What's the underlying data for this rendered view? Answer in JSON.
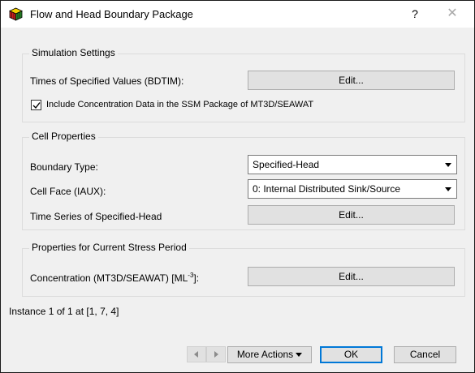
{
  "window": {
    "title": "Flow and Head Boundary Package",
    "help_label": "?",
    "close_label": "✕"
  },
  "simulation_settings": {
    "legend": "Simulation Settings",
    "times_label": "Times of Specified Values (BDTIM):",
    "times_button": "Edit...",
    "include_concentration_label": "Include Concentration Data in the SSM Package of MT3D/SEAWAT",
    "include_concentration_checked": true
  },
  "cell_properties": {
    "legend": "Cell Properties",
    "boundary_type_label": "Boundary Type:",
    "boundary_type_value": "Specified-Head",
    "cell_face_label": "Cell Face (IAUX):",
    "cell_face_value": "0: Internal Distributed Sink/Source",
    "time_series_label": "Time Series of Specified-Head",
    "time_series_button": "Edit..."
  },
  "stress_period": {
    "legend": "Properties for Current Stress Period",
    "concentration_label_prefix": "Concentration (MT3D/SEAWAT) [ML",
    "concentration_label_sup": "-3",
    "concentration_label_suffix": "]:",
    "concentration_button": "Edit..."
  },
  "instance_text": "Instance 1 of 1 at [1, 7, 4]",
  "footer": {
    "more_actions_label": "More Actions",
    "ok_label": "OK",
    "cancel_label": "Cancel"
  },
  "colors": {
    "dialog_background": "#f0f0f0",
    "button_face": "#e1e1e1",
    "ok_border": "#0078d7"
  },
  "icons": [
    "app-cube-icon",
    "help-icon",
    "close-icon",
    "checkmark-icon",
    "dropdown-arrow-icon",
    "previous-arrow-icon",
    "next-arrow-icon"
  ]
}
